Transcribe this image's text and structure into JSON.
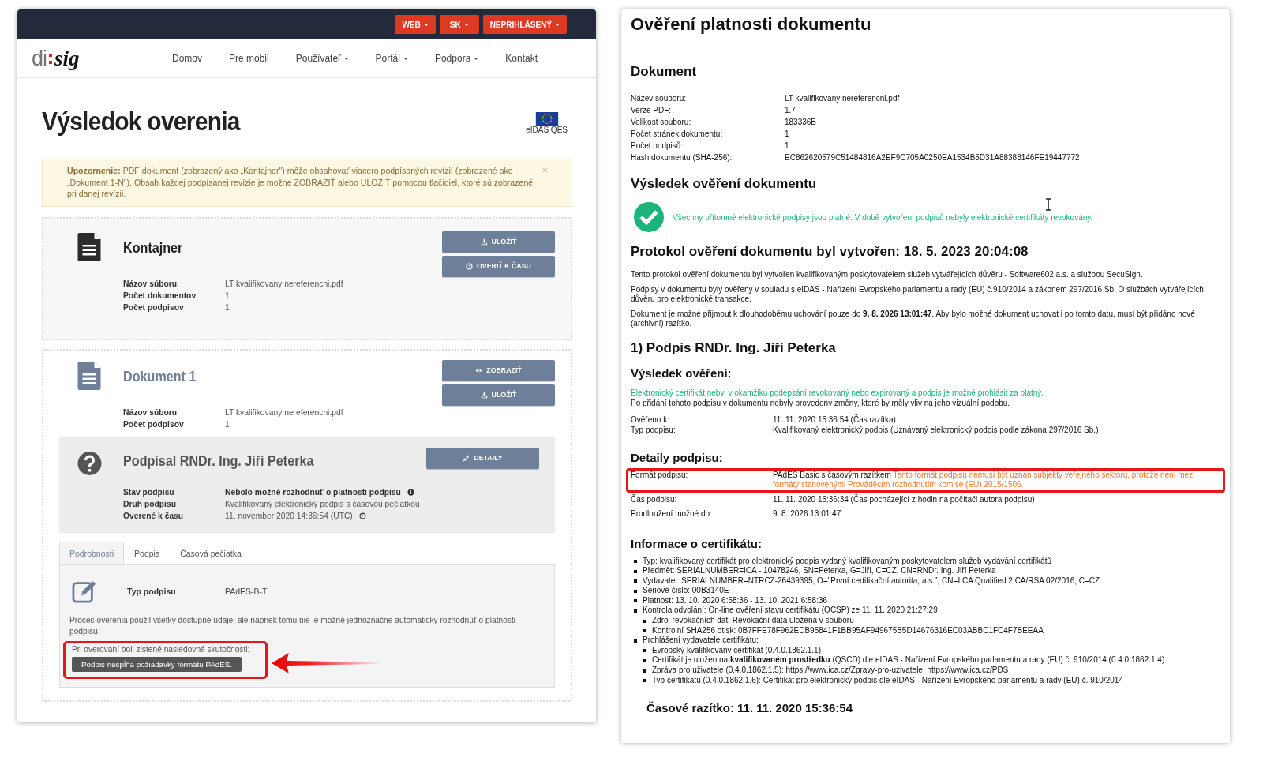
{
  "left": {
    "topbar": [
      {
        "label": "WEB"
      },
      {
        "label": "SK"
      },
      {
        "label": "NEPRIHLÁSENÝ"
      }
    ],
    "logo": {
      "part1": "di",
      "part2": "sig"
    },
    "nav": [
      {
        "label": "Domov",
        "dropdown": false
      },
      {
        "label": "Pre mobil",
        "dropdown": false
      },
      {
        "label": "Používateľ",
        "dropdown": true
      },
      {
        "label": "Portál",
        "dropdown": true
      },
      {
        "label": "Podpora",
        "dropdown": true
      },
      {
        "label": "Kontakt",
        "dropdown": false
      }
    ],
    "title": "Výsledok overenia",
    "badge": "eIDAS QES",
    "alert": {
      "text": "**Upozornenie:** PDF dokument (zobrazený ako „Kontajner\") môže obsahovať viacero podpísaných revízií (zobrazené ako „Dokument 1-N\"). Obsah každej podpísanej revízie je možné ZOBRAZIŤ alebo ULOŽIŤ pomocou tlačidiel, ktoré sú zobrazené pri danej revízii.",
      "close": "×"
    },
    "cards": [
      {
        "kind": "container",
        "title": "Kontajner",
        "fields": [
          {
            "label": "Názov súboru",
            "value": "LT kvalifikovany nereferencni.pdf"
          },
          {
            "label": "Počet dokumentov",
            "value": "1"
          },
          {
            "label": "Počet podpisov",
            "value": "1"
          }
        ],
        "buttons": [
          {
            "label": "ULOŽIŤ"
          },
          {
            "label": "OVERIŤ K ČASU"
          }
        ]
      },
      {
        "kind": "document",
        "title": "Dokument 1",
        "fields": [
          {
            "label": "Názov súboru",
            "value": "LT kvalifikovany nereferencni.pdf"
          },
          {
            "label": "Počet podpisov",
            "value": "1"
          }
        ],
        "buttons": [
          {
            "label": "ZOBRAZIŤ"
          },
          {
            "label": "ULOŽIŤ"
          }
        ]
      }
    ],
    "signature": {
      "title": "Podpísal RNDr. Ing. Jiří Peterka",
      "button": {
        "label": "DETAILY"
      },
      "fields": [
        {
          "label": "Stav podpisu",
          "value": "Nebolo možné rozhodnúť o platnosti podpisu",
          "strong": true
        },
        {
          "label": "Druh podpisu",
          "value": "Kvalifikovaný elektronický podpis s časovou pečiatkou",
          "strong": false
        },
        {
          "label": "Overené k času",
          "value": "11. november 2020 14:36:54 (UTC)",
          "strong": false
        }
      ]
    },
    "tabs": [
      {
        "label": "Podrobnosti",
        "selected": true
      },
      {
        "label": "Podpis",
        "selected": false
      },
      {
        "label": "Časová pečiatka",
        "selected": false
      }
    ],
    "panel": {
      "field_label": "Typ podpisu",
      "field_value": "PAdES-B-T",
      "description": "Proces overenia použil všetky dostupné údaje, ale napriek tomu nie je možné jednoznačne automaticky rozhodnúť o platnosti podpisu.",
      "findings_label": "Pri overovaní boli zistené nasledovné skutočnosti:",
      "findings": [
        "Podpis nespĺňa požiadavky formátu PAdES."
      ],
      "highlighted": true
    }
  },
  "right": {
    "title": "Ověření platnosti dokumentu",
    "document": {
      "heading": "Dokument",
      "rows": [
        {
          "label": "Název souboru:",
          "value": "LT kvalifikovany nereferencni.pdf"
        },
        {
          "label": "Verze PDF:",
          "value": "1.7"
        },
        {
          "label": "Velikost souboru:",
          "value": "183336B"
        },
        {
          "label": "Počet stránek dokumentu:",
          "value": "1"
        },
        {
          "label": "Počet podpisů:",
          "value": "1"
        },
        {
          "label": "Hash dokumentu (SHA-256):",
          "value": "EC862620579C51484816A2EF9C705A0250EA1534B5D31A88388146FE19447772"
        }
      ]
    },
    "result": {
      "heading": "Výsledek ověření dokumentu",
      "valid": true,
      "message": "Všechny přítomné elektronické podpisy jsou platné. V době vytvoření podpisů nebyly elektronické certifikáty revokovány."
    },
    "protocol": {
      "heading": "Protokol ověření dokumentu byl vytvořen: 18. 5. 2023 20:04:08",
      "paragraphs": [
        "Tento protokol ověření dokumentu byl vytvořen kvalifikovaným poskytovatelem služeb vytvářejících důvěru - Software602 a.s. a službou SecuSign.",
        "Podpisy v dokumentu byly ověřeny v souladu s eIDAS - Nařízení Evropského parlamentu a rady (EU) č.910/2014 a zákonem 297/2016 Sb. O službách vytvářejících důvěru pro elektronické transakce.",
        "Dokument je možné přijmout k dlouhodobému uchování pouze do **9. 8. 2026 13:01:47**. Aby bylo možné dokument uchovat i po tomto datu, musí být přidáno nové (archivní) razítko."
      ]
    },
    "signature": {
      "heading": "1) Podpis RNDr. Ing. Jiří Peterka",
      "result_heading": "Výsledek ověření:",
      "valid_text": "Elektronický certifikát nebyl v okamžiku podepsání revokovaný nebo expirovaný a podpis je možné prohlásit za platný.",
      "note": "Po přidání tohoto podpisu v dokumentu nebyly provedeny změny, které by měly vliv na jeho vizuální podobu.",
      "rows": [
        {
          "label": "Ověřeno k:",
          "value": "11. 11. 2020 15:36:54 (Čas razítka)"
        },
        {
          "label": "Typ podpisu:",
          "value": "Kvalifikovaný elektronický podpis (Uznávaný elektronický podpis podle zákona 297/2016 Sb.)"
        }
      ]
    },
    "details": {
      "heading": "Detaily podpisu:",
      "rows": [
        {
          "label": "Formát podpisu:",
          "value": "PAdES Basic s časovým razítkem",
          "warning": "Tento formát podpisu nemusí být uznán subjekty veřejného sektoru, protože není mezi formáty stanovenými Prováděcím rozhodnutím komise (EU) 2015/1506.",
          "highlighted": true
        },
        {
          "label": "Čas podpisu:",
          "value": "11. 11. 2020 15:36:34 (Čas pocházející z hodin na počítači autora podpisu)",
          "highlighted": false
        },
        {
          "label": "Prodloužení možné do:",
          "value": "9. 8. 2026 13:01:47",
          "highlighted": false
        }
      ]
    },
    "certificate": {
      "heading": "Informace o certifikátu:",
      "items": [
        {
          "text": "Typ: kvalifikovaný certifikát pro elektronický podpis vydaný kvalifikovaným poskytovatelem služeb vydávání certifikátů"
        },
        {
          "text": "Předmět: SERIALNUMBER=ICA - 10478246, SN=Peterka, G=Jiří, C=CZ, CN=RNDr. Ing. Jiří Peterka"
        },
        {
          "text": "Vydavatel: SERIALNUMBER=NTRCZ-26439395, O=\"První certifikační autorita, a.s.\", CN=I.CA Qualified 2 CA/RSA 02/2016, C=CZ"
        },
        {
          "text": "Sériové číslo: 00B3140E"
        },
        {
          "text": "Platnost: 13. 10. 2020 6:58:36 - 13. 10. 2021 6:58:36"
        },
        {
          "text": "Kontrola odvolání: On-line ověření stavu certifikátu (OCSP) ze 11. 11. 2020 21:27:29",
          "children": [
            {
              "text": "Zdroj revokačních dat: Revokační data uložená v souboru"
            },
            {
              "text": "Kontrolní SHA256 otisk: 0B7FFE78F962EDB95841F1BB95AF949675B5D14676316EC03ABBC1FC4F7BEEAA"
            }
          ]
        },
        {
          "text": "Prohlášení vydavatele certifikátu:",
          "children": [
            {
              "text": "Evropský kvalifikovaný certifikát (0.4.0.1862.1.1)"
            },
            {
              "text": "Certifikát je uložen na **kvalifikovaném prostředku** (QSCD) dle eIDAS - Nařízení Evropského parlamentu a rady (EU) č. 910/2014 (0.4.0.1862.1.4)"
            },
            {
              "text": "Zpráva pro uživatele (0.4.0.1862.1.5): https://www.ica.cz/Zpravy-pro-uzivatele; https://www.ica.cz/PDS"
            },
            {
              "text": "Typ certifikátu (0.4.0.1862.1.6): Certifikát pro elektronický podpis dle eIDAS - Nařízení Evropského parlamentu a rady (EU) č. 910/2014"
            }
          ]
        }
      ]
    },
    "timestamp_heading": "Časové razítko: 11. 11. 2020 15:36:54"
  }
}
